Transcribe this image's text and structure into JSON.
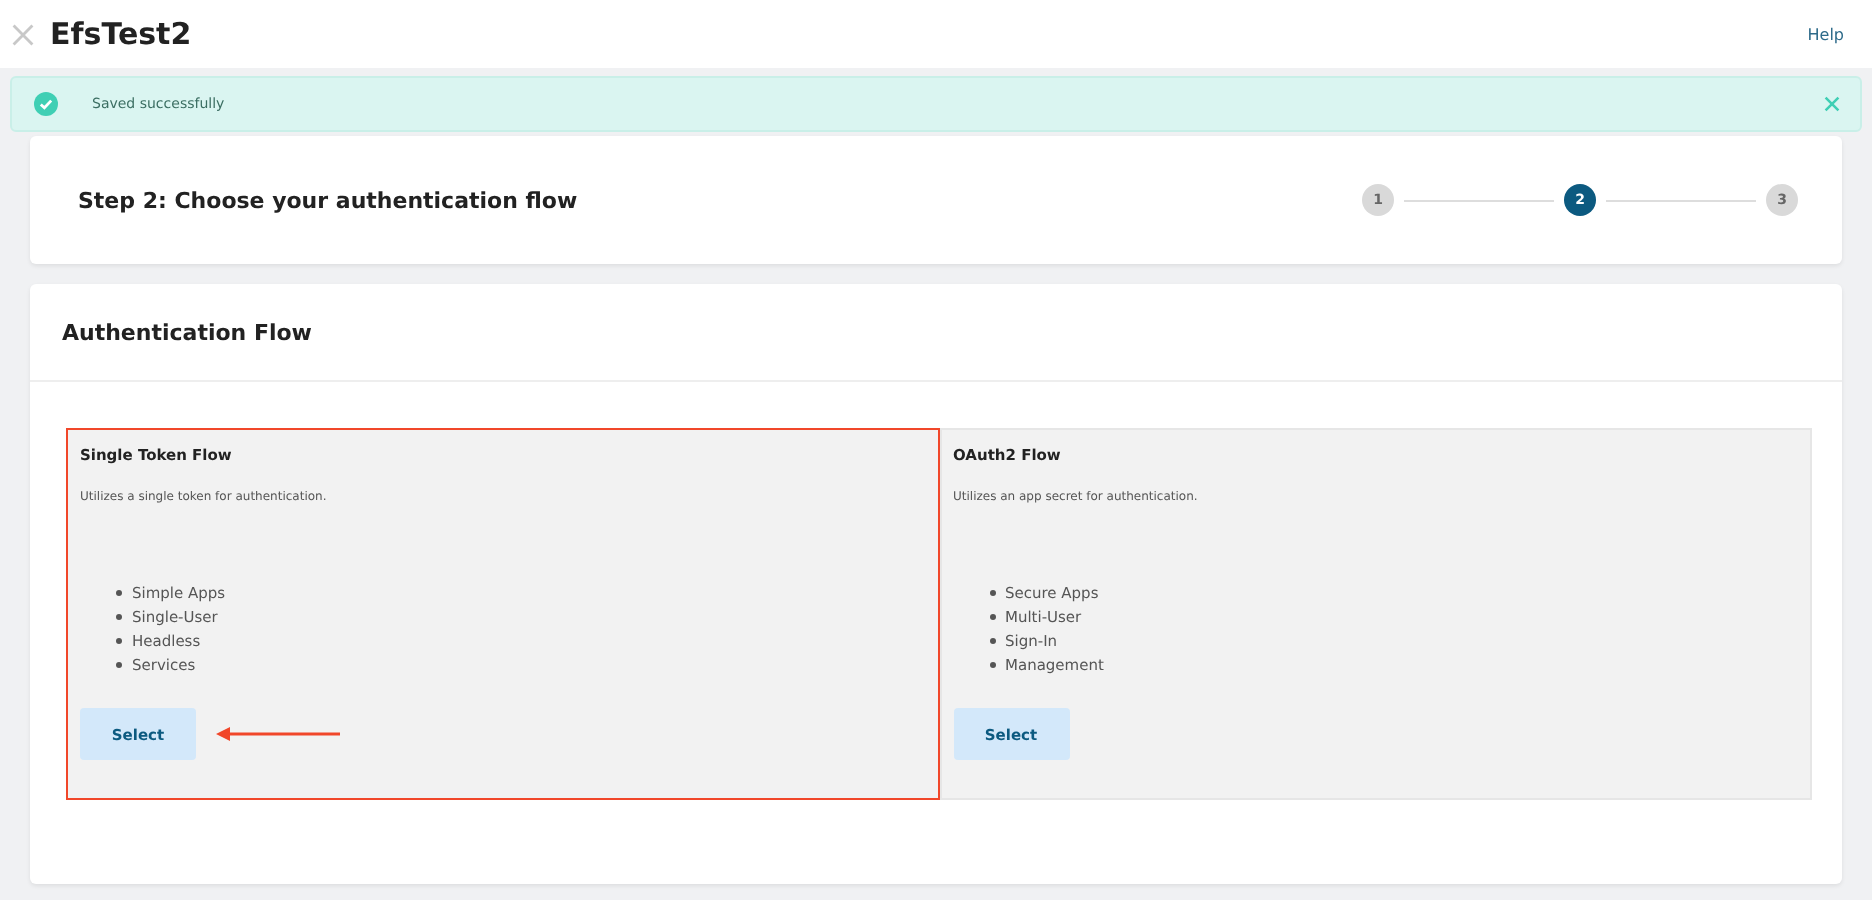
{
  "header": {
    "title": "EfsTest2",
    "help": "Help"
  },
  "toast": {
    "message": "Saved successfully"
  },
  "step_card": {
    "title": "Step 2: Choose your authentication flow",
    "steps": [
      {
        "label": "1",
        "selected": false
      },
      {
        "label": "2",
        "selected": true
      },
      {
        "label": "3",
        "selected": false
      }
    ]
  },
  "auth_card": {
    "title": "Authentication Flow",
    "options": [
      {
        "title": "Single Token Flow",
        "description": "Utilizes a single token for authentication.",
        "features": [
          "Simple Apps",
          "Single-User",
          "Headless",
          "Services"
        ],
        "button": "Select",
        "highlighted": true
      },
      {
        "title": "OAuth2 Flow",
        "description": "Utilizes an app secret for authentication.",
        "features": [
          "Secure Apps",
          "Multi-User",
          "Sign-In",
          "Management"
        ],
        "button": "Select",
        "highlighted": false
      }
    ]
  }
}
